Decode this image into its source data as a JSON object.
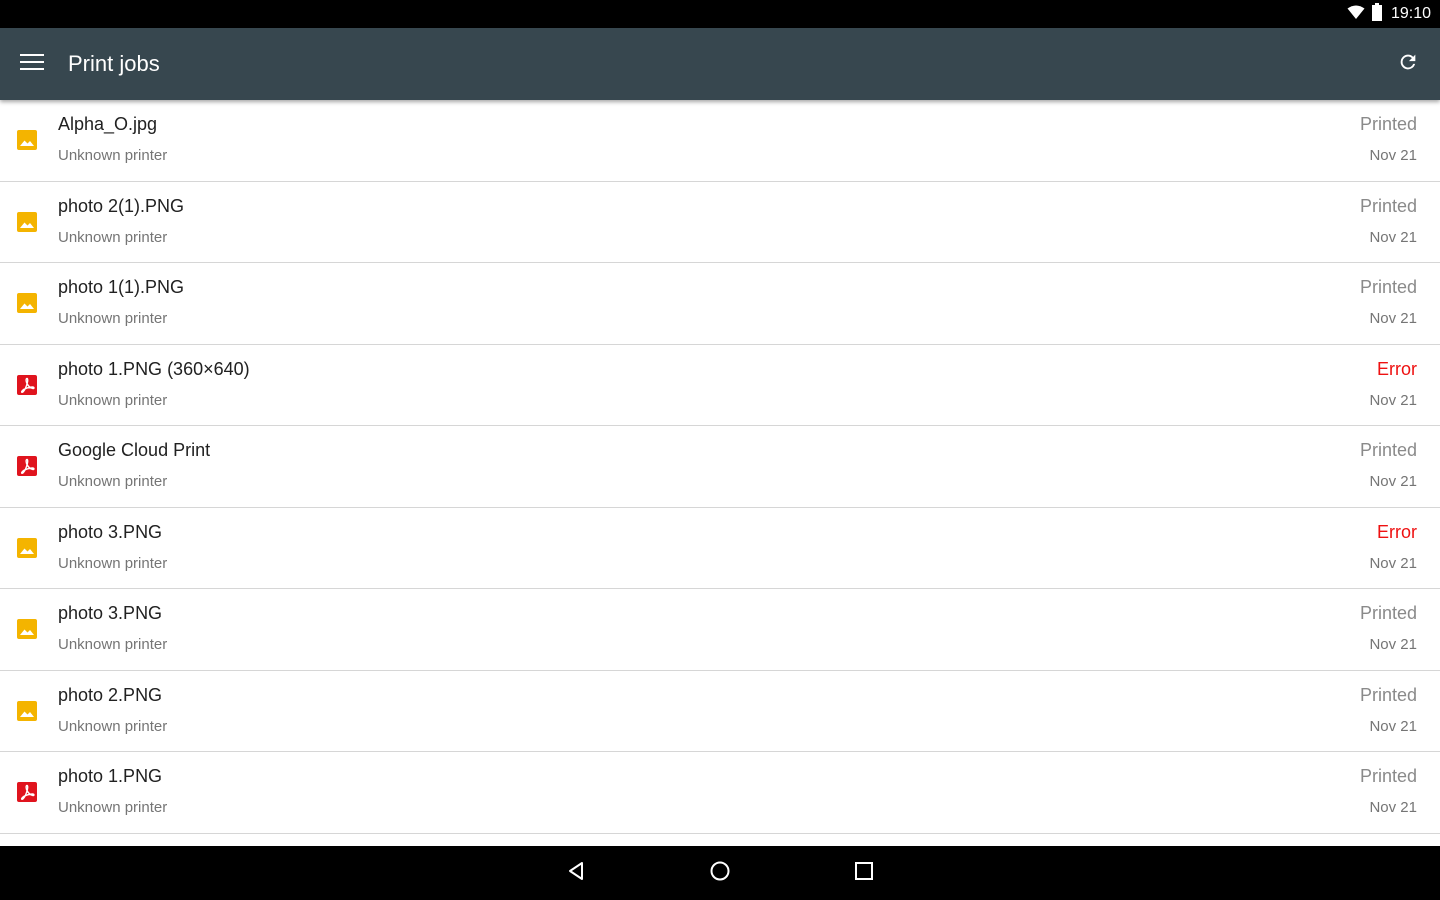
{
  "status_bar": {
    "time": "19:10",
    "icons": [
      "wifi-icon",
      "battery-icon"
    ]
  },
  "app_bar": {
    "title": "Print jobs",
    "background": "#37474f",
    "menu_icon": "menu-icon",
    "refresh_icon": "refresh-icon"
  },
  "colors": {
    "image_icon": "#f4b400",
    "pdf_icon": "#e0141e",
    "error_text": "#ee1111",
    "printed_text": "#8a8a8a"
  },
  "jobs": [
    {
      "name": "Alpha_O.jpg",
      "printer": "Unknown printer",
      "status": "Printed",
      "date": "Nov 21",
      "type": "image-icon"
    },
    {
      "name": "photo 2(1).PNG",
      "printer": "Unknown printer",
      "status": "Printed",
      "date": "Nov 21",
      "type": "image-icon"
    },
    {
      "name": "photo 1(1).PNG",
      "printer": "Unknown printer",
      "status": "Printed",
      "date": "Nov 21",
      "type": "image-icon"
    },
    {
      "name": "photo 1.PNG (360×640)",
      "printer": "Unknown printer",
      "status": "Error",
      "date": "Nov 21",
      "type": "pdf-icon"
    },
    {
      "name": "Google Cloud Print",
      "printer": "Unknown printer",
      "status": "Printed",
      "date": "Nov 21",
      "type": "pdf-icon"
    },
    {
      "name": "photo 3.PNG",
      "printer": "Unknown printer",
      "status": "Error",
      "date": "Nov 21",
      "type": "image-icon"
    },
    {
      "name": "photo 3.PNG",
      "printer": "Unknown printer",
      "status": "Printed",
      "date": "Nov 21",
      "type": "image-icon"
    },
    {
      "name": "photo 2.PNG",
      "printer": "Unknown printer",
      "status": "Printed",
      "date": "Nov 21",
      "type": "image-icon"
    },
    {
      "name": "photo 1.PNG",
      "printer": "Unknown printer",
      "status": "Printed",
      "date": "Nov 21",
      "type": "pdf-icon"
    }
  ],
  "nav_bar": {
    "buttons": [
      "back-icon",
      "home-icon",
      "recents-icon"
    ]
  }
}
